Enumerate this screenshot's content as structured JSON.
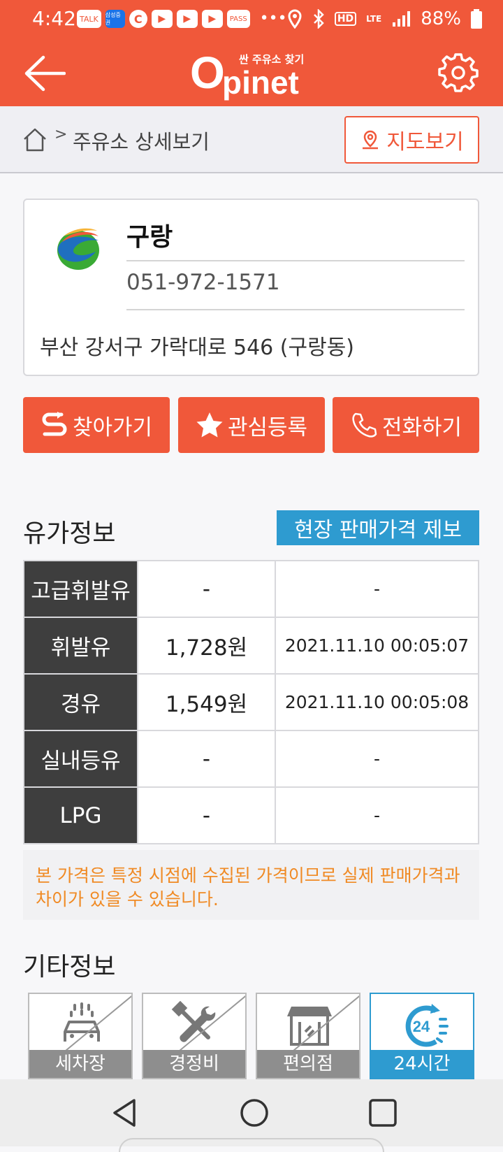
{
  "status_bar": {
    "time": "4:42",
    "app_badges": [
      "TALK",
      "삼성증권",
      "C",
      "▶",
      "▶",
      "▶",
      "PASS",
      "•••"
    ],
    "network_label": "LTE",
    "hd_label": "HD",
    "battery": "88%"
  },
  "app_bar": {
    "logo_letter": "O",
    "logo_word": "pinet",
    "logo_subtitle": "싼 주유소 찾기"
  },
  "breadcrumb": {
    "separator": ">",
    "current": "주유소 상세보기",
    "map_button": "지도보기"
  },
  "station": {
    "name": "구랑",
    "phone": "051-972-1571",
    "address": "부산 강서구 가락대로 546 (구랑동)"
  },
  "actions": {
    "navigate": "찾아가기",
    "favorite": "관심등록",
    "call": "전화하기"
  },
  "price_section": {
    "title": "유가정보",
    "report_button": "현장 판매가격 제보",
    "rows": [
      {
        "fuel": "고급휘발유",
        "price": "-",
        "date": "-"
      },
      {
        "fuel": "휘발유",
        "price": "1,728원",
        "date": "2021.11.10 00:05:07"
      },
      {
        "fuel": "경유",
        "price": "1,549원",
        "date": "2021.11.10 00:05:08"
      },
      {
        "fuel": "실내등유",
        "price": "-",
        "date": "-"
      },
      {
        "fuel": "LPG",
        "price": "-",
        "date": "-"
      }
    ],
    "notice": "본 가격은 특정 시점에 수집된 가격이므로 실제 판매가격과 차이가 있을 수 있습니다."
  },
  "other_section": {
    "title": "기타정보",
    "services": [
      {
        "label": "세차장",
        "available": false
      },
      {
        "label": "경정비",
        "available": false
      },
      {
        "label": "편의점",
        "available": false
      },
      {
        "label": "24시간",
        "available": true,
        "badge": "24"
      }
    ]
  },
  "colors": {
    "brand": "#f0583a",
    "info_blue": "#2e9bd0",
    "notice_orange": "#f08a24",
    "table_header": "#3e3e3e"
  }
}
